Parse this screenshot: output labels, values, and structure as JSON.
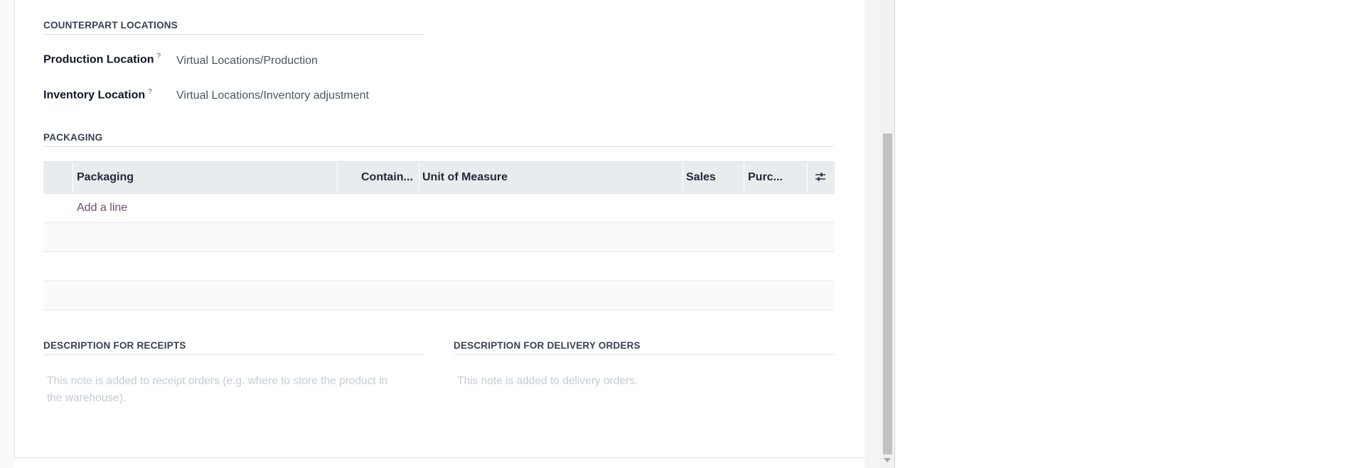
{
  "counterpart": {
    "title": "COUNTERPART LOCATIONS",
    "fields": [
      {
        "label": "Production Location",
        "help": "?",
        "value": "Virtual Locations/Production"
      },
      {
        "label": "Inventory Location",
        "help": "?",
        "value": "Virtual Locations/Inventory adjustment"
      }
    ]
  },
  "packaging": {
    "title": "PACKAGING",
    "columns": [
      "Packaging",
      "Contain...",
      "Unit of Measure",
      "Sales",
      "Purc..."
    ],
    "add_line": "Add a line",
    "settings_icon": "sliders-icon"
  },
  "receipts": {
    "title": "DESCRIPTION FOR RECEIPTS",
    "placeholder": "This note is added to receipt orders (e.g. where to store the product in the warehouse)."
  },
  "delivery": {
    "title": "DESCRIPTION FOR DELIVERY ORDERS",
    "placeholder": "This note is added to delivery orders."
  }
}
